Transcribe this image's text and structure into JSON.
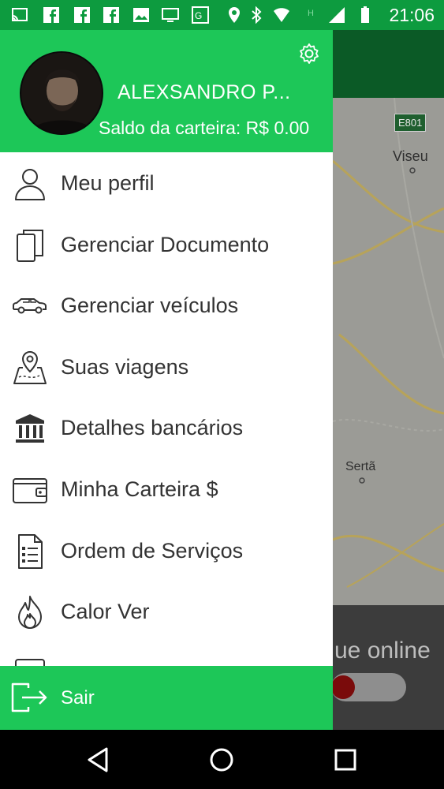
{
  "status_bar": {
    "time": "21:06",
    "icons": [
      "cast-icon",
      "facebook-icon",
      "facebook-icon",
      "facebook-icon",
      "image-icon",
      "tv-icon",
      "maps-icon",
      "location-icon",
      "bluetooth-icon",
      "wifi-icon",
      "h-network-icon",
      "signal-icon",
      "battery-icon"
    ]
  },
  "drawer": {
    "user_name": "ALEXSANDRO P...",
    "wallet_balance": "Saldo da carteira: R$ 0.00",
    "menu": [
      {
        "label": "Meu perfil",
        "icon": "user-icon"
      },
      {
        "label": "Gerenciar Documento",
        "icon": "documents-icon"
      },
      {
        "label": "Gerenciar veículos",
        "icon": "car-icon"
      },
      {
        "label": "Suas viagens",
        "icon": "map-pin-icon"
      },
      {
        "label": "Detalhes bancários",
        "icon": "bank-icon"
      },
      {
        "label": "Minha Carteira $",
        "icon": "wallet-icon"
      },
      {
        "label": "Ordem de Serviços",
        "icon": "checklist-icon"
      },
      {
        "label": "Calor Ver",
        "icon": "flame-icon"
      }
    ],
    "logout_label": "Sair"
  },
  "map": {
    "road_label": "E801",
    "city_labels": [
      "Viseu",
      "Sertã"
    ],
    "online_text": "ue online"
  },
  "colors": {
    "status_bar": "#0d9b3f",
    "drawer_green": "#1dc758"
  }
}
